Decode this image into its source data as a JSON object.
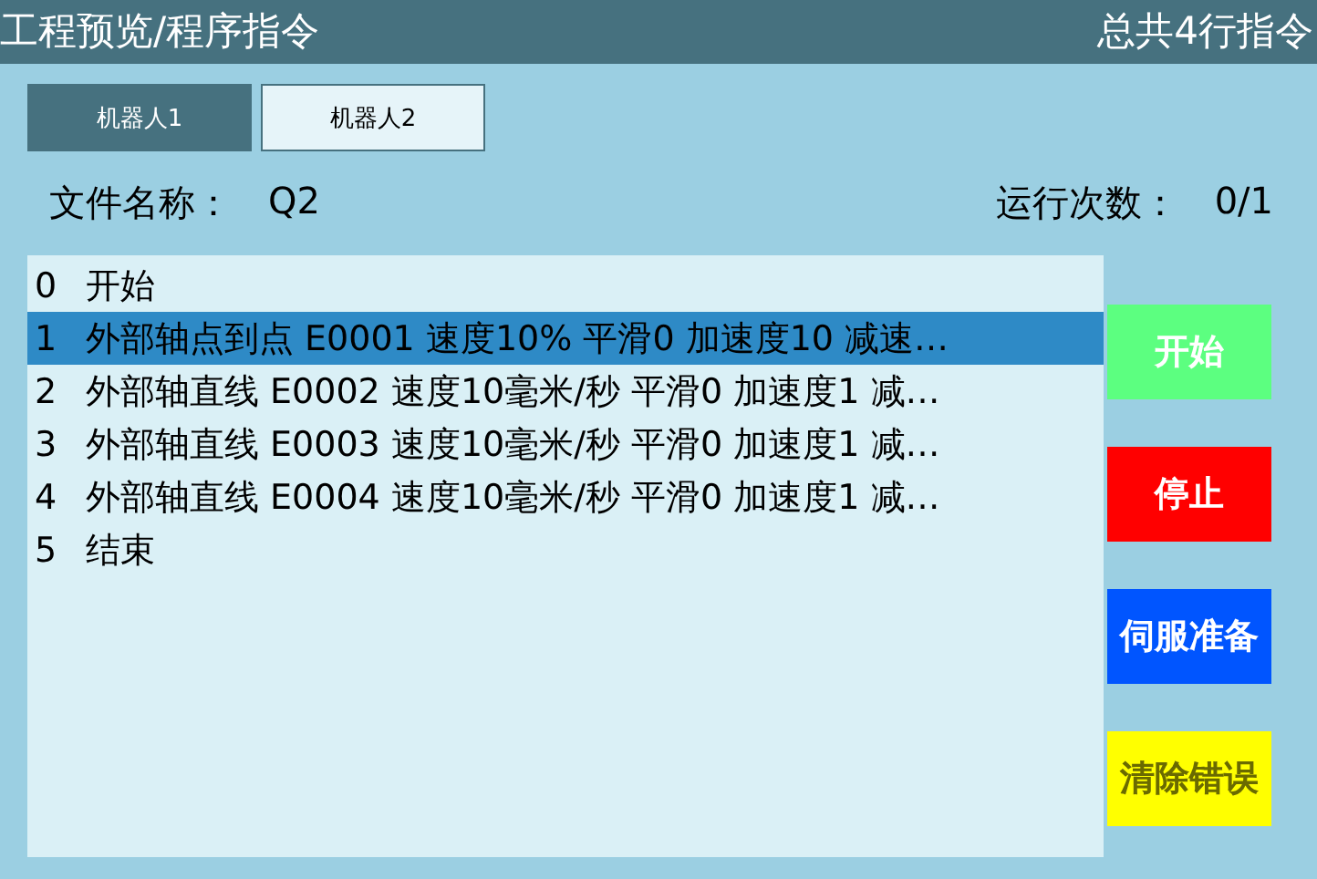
{
  "header": {
    "title": "工程预览/程序指令",
    "summary": "总共4行指令"
  },
  "tabs": [
    {
      "label": "机器人1",
      "selected": true
    },
    {
      "label": "机器人2",
      "selected": false
    }
  ],
  "file": {
    "label": "文件名称：",
    "value": "Q2"
  },
  "runs": {
    "label": "运行次数：",
    "value": "0/1"
  },
  "program": [
    {
      "index": "0",
      "text": "开始",
      "selected": false
    },
    {
      "index": "1",
      "text": "外部轴点到点 E0001 速度10% 平滑0 加速度10 减速…",
      "selected": true
    },
    {
      "index": "2",
      "text": "外部轴直线 E0002 速度10毫米/秒 平滑0 加速度1 减…",
      "selected": false
    },
    {
      "index": "3",
      "text": "外部轴直线 E0003 速度10毫米/秒 平滑0 加速度1 减…",
      "selected": false
    },
    {
      "index": "4",
      "text": "外部轴直线 E0004 速度10毫米/秒 平滑0 加速度1 减…",
      "selected": false
    },
    {
      "index": "5",
      "text": "结束",
      "selected": false
    }
  ],
  "buttons": [
    {
      "label": "开始",
      "color": "#5cff80"
    },
    {
      "label": "停止",
      "color": "#ff0000"
    },
    {
      "label": "伺服准备",
      "color": "#0055ff"
    },
    {
      "label": "清除错误",
      "color": "#ffff00"
    }
  ]
}
